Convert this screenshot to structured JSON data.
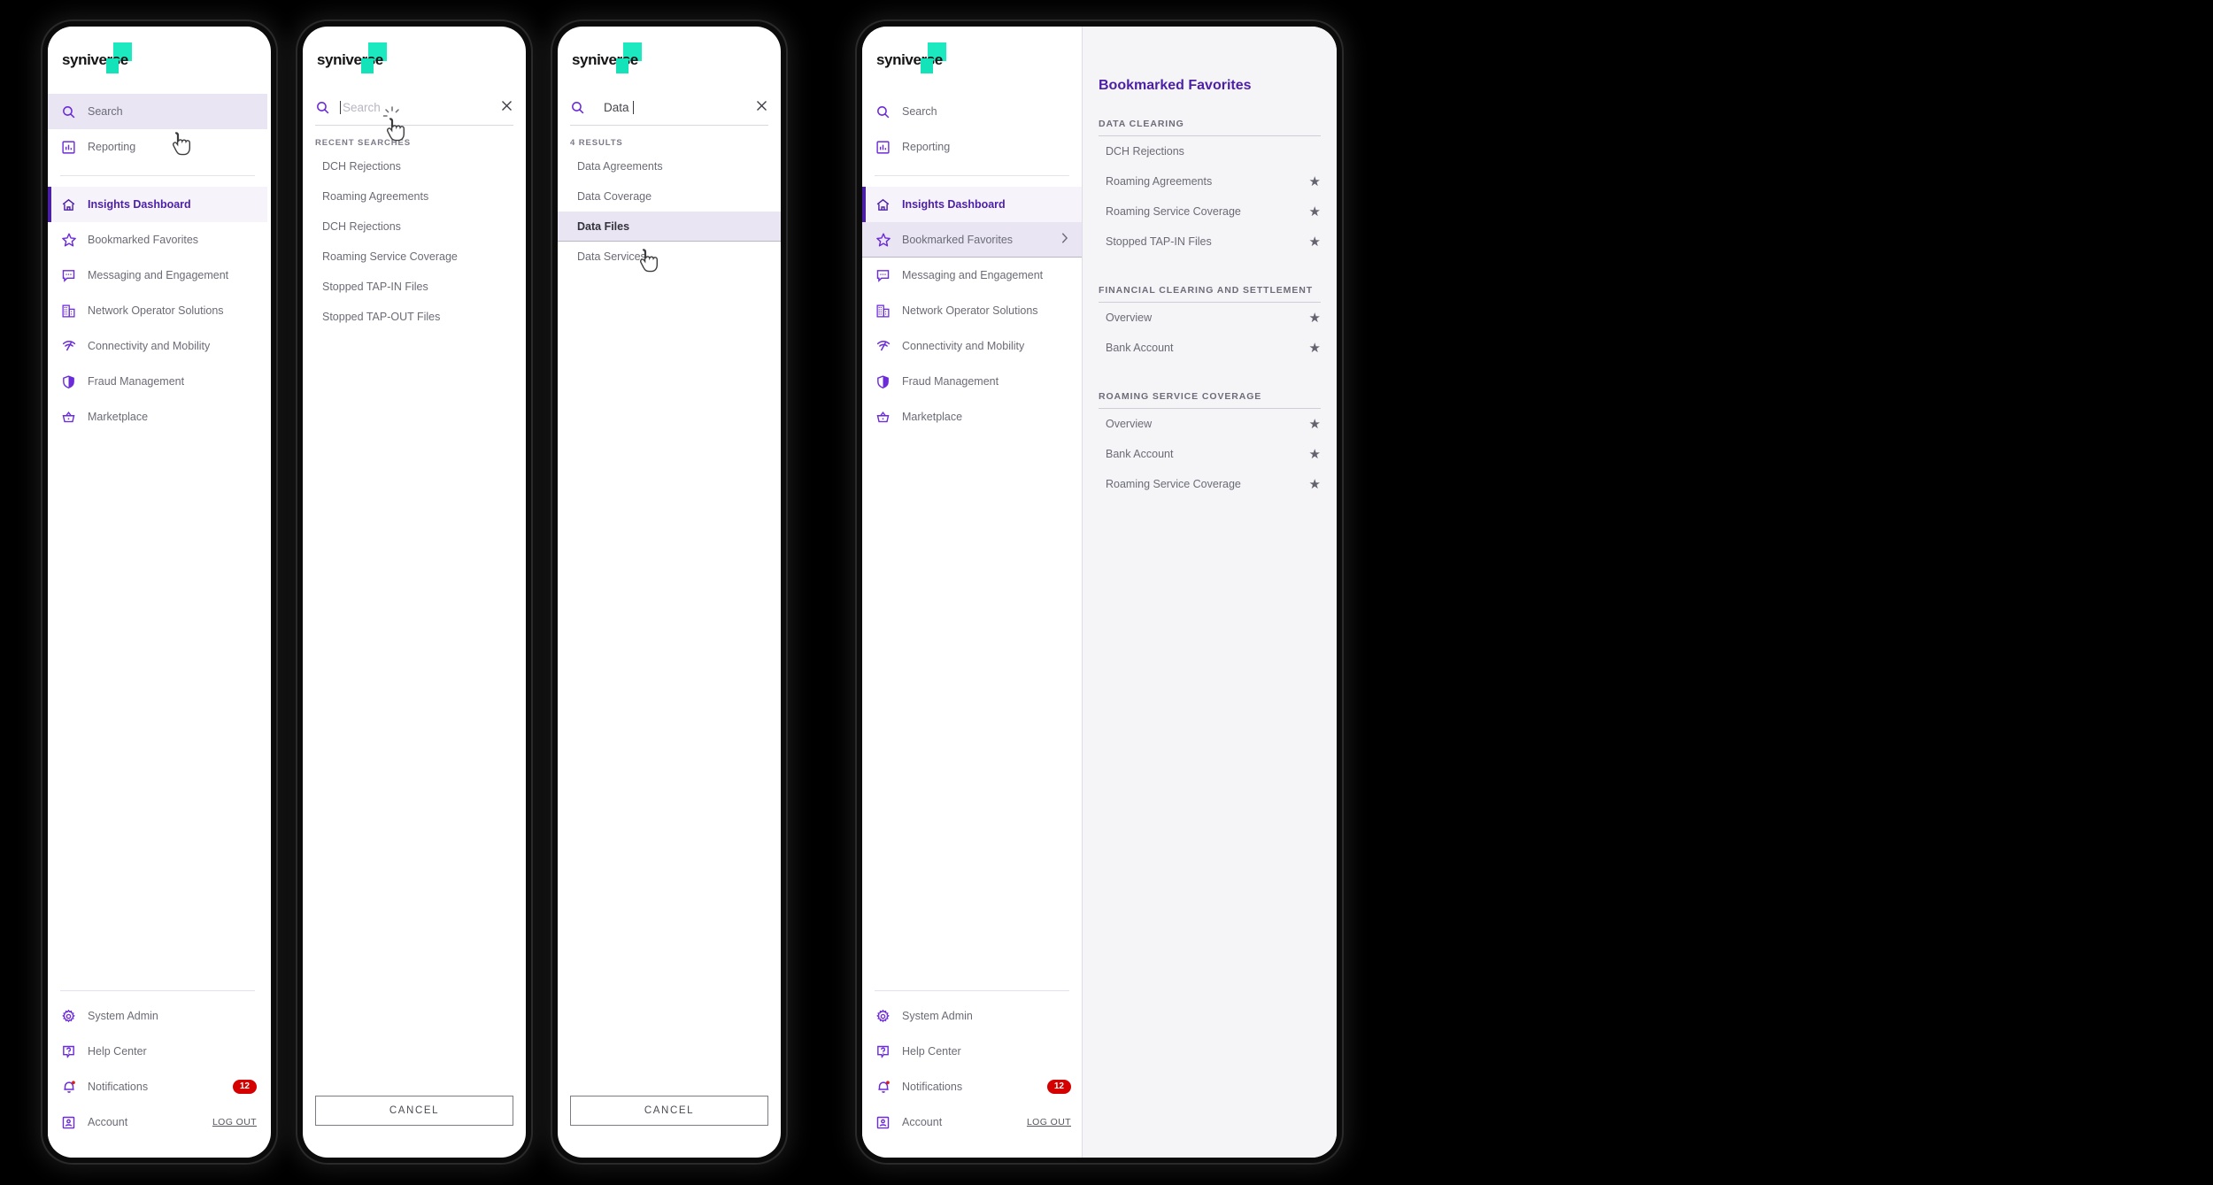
{
  "brand": {
    "name": "syniverse"
  },
  "sidebar": {
    "top_items": [
      {
        "label": "Search",
        "icon": "search-icon"
      },
      {
        "label": "Reporting",
        "icon": "bar-chart-icon"
      }
    ],
    "main_items": [
      {
        "label": "Insights Dashboard",
        "icon": "home-icon"
      },
      {
        "label": "Bookmarked Favorites",
        "icon": "star-outline-icon"
      },
      {
        "label": "Messaging and Engagement",
        "icon": "chat-icon"
      },
      {
        "label": "Network Operator Solutions",
        "icon": "building-icon"
      },
      {
        "label": "Connectivity and Mobility",
        "icon": "signal-icon"
      },
      {
        "label": "Fraud Management",
        "icon": "shield-icon"
      },
      {
        "label": "Marketplace",
        "icon": "basket-icon"
      }
    ],
    "footer_items": [
      {
        "label": "System Admin",
        "icon": "gear-icon"
      },
      {
        "label": "Help Center",
        "icon": "help-icon"
      },
      {
        "label": "Notifications",
        "icon": "bell-icon",
        "badge": "12"
      },
      {
        "label": "Account",
        "icon": "account-icon",
        "action": "LOG OUT"
      }
    ]
  },
  "panel2": {
    "search": {
      "value": "",
      "placeholder": "Search"
    },
    "close_label": "close-icon",
    "section_title": "RECENT SEARCHES",
    "recent": [
      "DCH Rejections",
      "Roaming Agreements",
      "DCH Rejections",
      "Roaming Service Coverage",
      "Stopped TAP-IN Files",
      "Stopped TAP-OUT Files"
    ],
    "cancel_label": "CANCEL"
  },
  "panel3": {
    "search": {
      "value": "Data",
      "placeholder": "Search"
    },
    "section_title": "4 RESULTS",
    "results": [
      {
        "label": "Data Agreements",
        "selected": false
      },
      {
        "label": "Data Coverage",
        "selected": false
      },
      {
        "label": "Data Files",
        "selected": true
      },
      {
        "label": "Data Services",
        "selected": false
      }
    ],
    "cancel_label": "CANCEL"
  },
  "panel4": {
    "flyout_title": "Bookmarked Favorites",
    "groups": [
      {
        "title": "DATA CLEARING",
        "items": [
          {
            "label": "DCH Rejections",
            "starred": false
          },
          {
            "label": "Roaming Agreements",
            "starred": true
          },
          {
            "label": "Roaming Service Coverage",
            "starred": true
          },
          {
            "label": "Stopped TAP-IN Files",
            "starred": true
          }
        ]
      },
      {
        "title": "FINANCIAL CLEARING AND SETTLEMENT",
        "items": [
          {
            "label": "Overview",
            "starred": true
          },
          {
            "label": "Bank Account",
            "starred": true
          }
        ]
      },
      {
        "title": "ROAMING SERVICE COVERAGE",
        "items": [
          {
            "label": "Overview",
            "starred": true
          },
          {
            "label": "Bank Account",
            "starred": true
          },
          {
            "label": "Roaming Service Coverage",
            "starred": true
          }
        ]
      }
    ]
  },
  "colors": {
    "accent_purple": "#6c2bd9",
    "active_purple": "#4c1fa8",
    "highlight": "#e9e5f3",
    "brand_teal": "#14e3ba",
    "badge_red": "#d50000"
  }
}
